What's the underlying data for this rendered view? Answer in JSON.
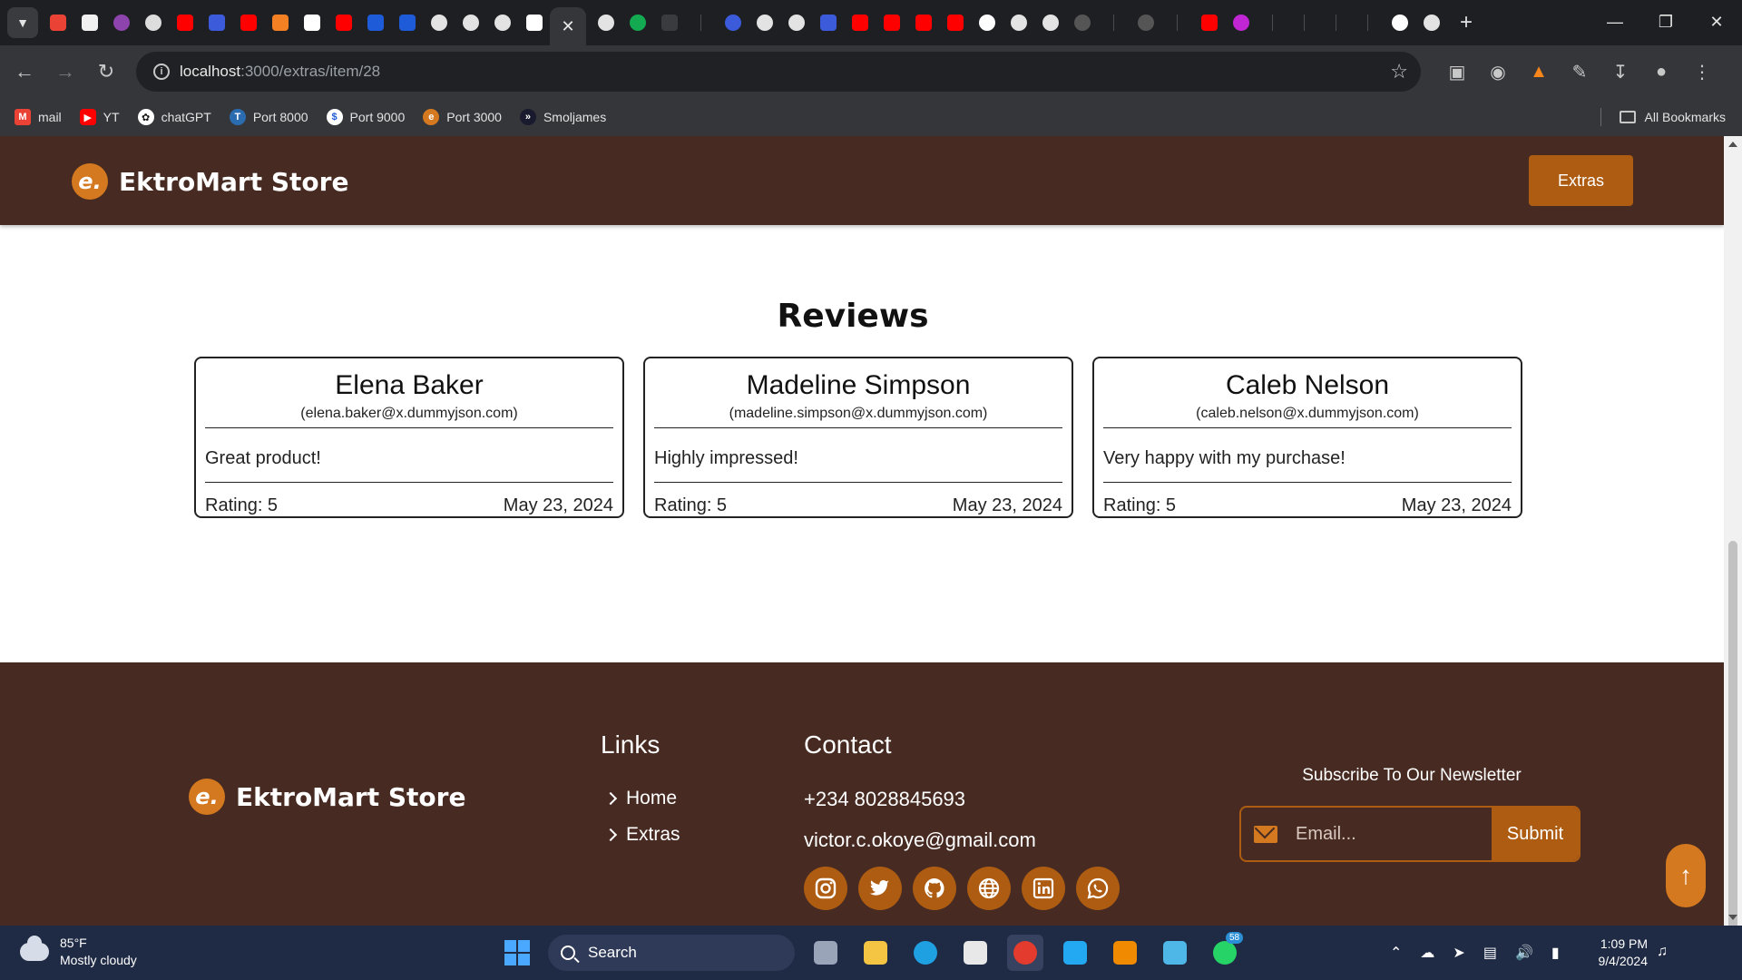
{
  "browser": {
    "url_host": "localhost",
    "url_rest": ":3000/extras/item/28",
    "bookmarks": [
      "mail",
      "YT",
      "chatGPT",
      "Port 8000",
      "Port 9000",
      "Port 3000",
      "Smoljames"
    ],
    "all_bookmarks": "All Bookmarks"
  },
  "header": {
    "logo_letter": "e.",
    "brand": "EktroMart Store",
    "extras_button": "Extras"
  },
  "reviews": {
    "title": "Reviews",
    "items": [
      {
        "name": "Elena Baker",
        "email": "(elena.baker@x.dummyjson.com)",
        "comment": "Great product!",
        "rating": "Rating: 5",
        "date": "May 23, 2024"
      },
      {
        "name": "Madeline Simpson",
        "email": "(madeline.simpson@x.dummyjson.com)",
        "comment": "Highly impressed!",
        "rating": "Rating: 5",
        "date": "May 23, 2024"
      },
      {
        "name": "Caleb Nelson",
        "email": "(caleb.nelson@x.dummyjson.com)",
        "comment": "Very happy with my purchase!",
        "rating": "Rating: 5",
        "date": "May 23, 2024"
      }
    ]
  },
  "footer": {
    "brand": "EktroMart Store",
    "logo_letter": "e.",
    "links_heading": "Links",
    "links": [
      "Home",
      "Extras"
    ],
    "contact_heading": "Contact",
    "phone": "+234 8028845693",
    "email": "victor.c.okoye@gmail.com",
    "socials": [
      "instagram-icon",
      "twitter-icon",
      "github-icon",
      "globe-icon",
      "linkedin-icon",
      "whatsapp-icon"
    ],
    "newsletter_label": "Subscribe To Our Newsletter",
    "email_placeholder": "Email...",
    "submit": "Submit"
  },
  "taskbar": {
    "temp": "85°F",
    "weather": "Mostly cloudy",
    "search": "Search",
    "time": "1:09 PM",
    "date": "9/4/2024",
    "whatsapp_badge": "58"
  },
  "colors": {
    "brand_brown": "#472a21",
    "accent_orange": "#ad5c12",
    "logo_orange": "#d4791f"
  }
}
